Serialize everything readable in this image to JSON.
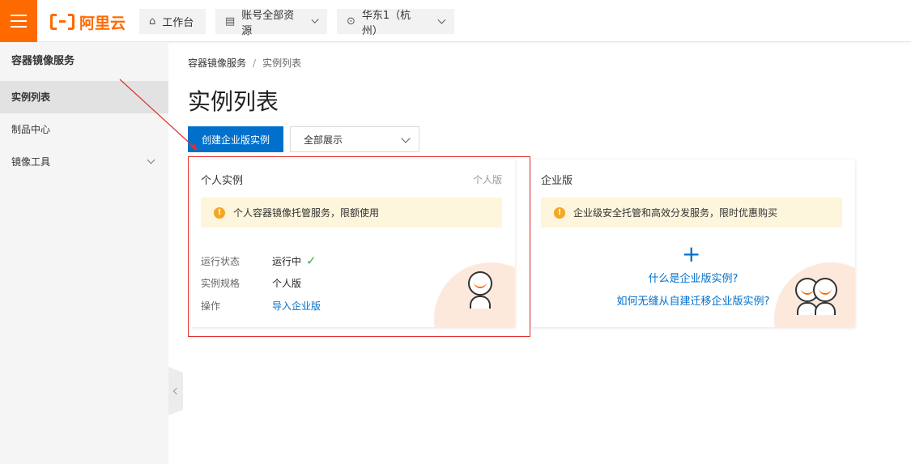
{
  "topbar": {
    "brand": "阿里云",
    "workbench": "工作台",
    "resources": "账号全部资源",
    "region": "华东1（杭州）"
  },
  "sidebar": {
    "title": "容器镜像服务",
    "items": [
      {
        "label": "实例列表",
        "active": true
      },
      {
        "label": "制品中心",
        "active": false
      },
      {
        "label": "镜像工具",
        "active": false,
        "expandable": true
      }
    ]
  },
  "breadcrumb": {
    "root": "容器镜像服务",
    "sep": "/",
    "current": "实例列表"
  },
  "page": {
    "title": "实例列表",
    "create_button": "创建企业版实例",
    "filter_value": "全部展示"
  },
  "personal_card": {
    "title": "个人实例",
    "tag": "个人版",
    "notice": "个人容器镜像托管服务，限额使用",
    "rows": [
      {
        "key": "运行状态",
        "value": "运行中"
      },
      {
        "key": "实例规格",
        "value": "个人版"
      },
      {
        "key": "操作",
        "value": "导入企业版"
      }
    ]
  },
  "enterprise_card": {
    "title": "企业版",
    "notice": "企业级安全托管和高效分发服务，限时优惠购买",
    "link1": "什么是企业版实例?",
    "link2": "如何无缝从自建迁移企业版实例?"
  },
  "colors": {
    "brand": "#ff6a00",
    "primary": "#0070cc",
    "notice_bg": "#fdf5dc",
    "highlight": "#e03030"
  }
}
